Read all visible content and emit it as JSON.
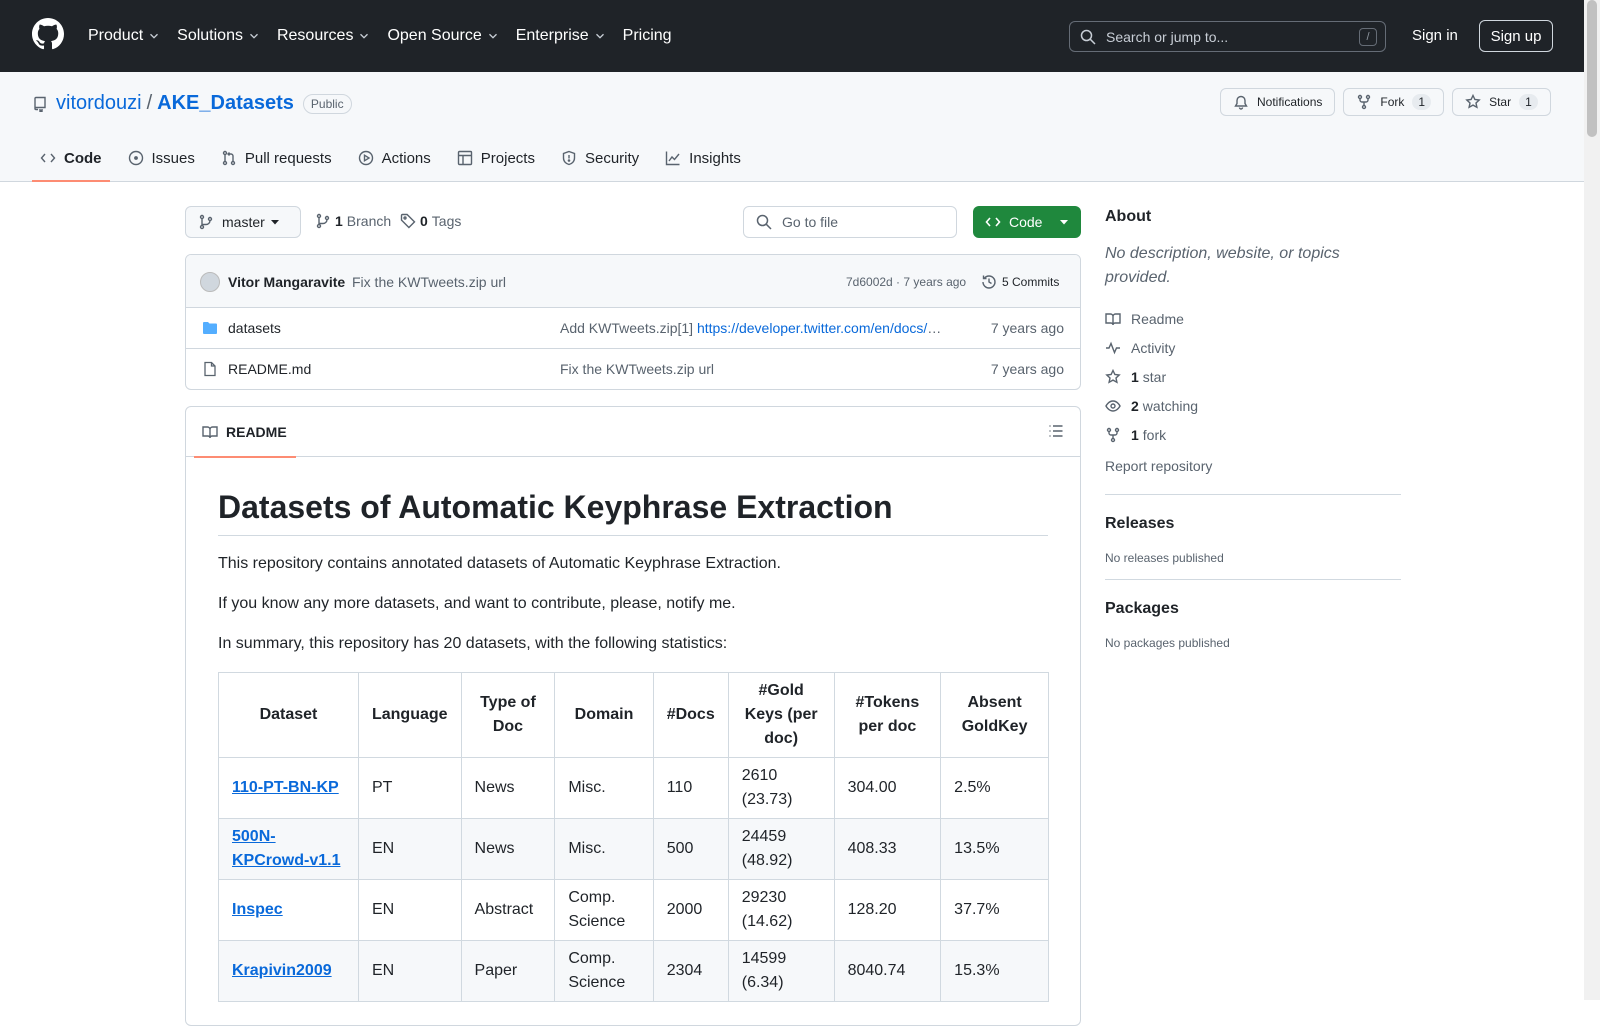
{
  "header": {
    "nav": [
      "Product",
      "Solutions",
      "Resources",
      "Open Source",
      "Enterprise",
      "Pricing"
    ],
    "nav_has_dropdown": [
      true,
      true,
      true,
      true,
      true,
      false
    ],
    "search_placeholder": "Search or jump to...",
    "search_shortcut": "/",
    "signin": "Sign in",
    "signup": "Sign up"
  },
  "repo": {
    "owner": "vitordouzi",
    "separator": "/",
    "name": "AKE_Datasets",
    "visibility": "Public",
    "notifications_label": "Notifications",
    "fork_label": "Fork",
    "fork_count": "1",
    "star_label": "Star",
    "star_count": "1"
  },
  "tabs": [
    "Code",
    "Issues",
    "Pull requests",
    "Actions",
    "Projects",
    "Security",
    "Insights"
  ],
  "toolbar": {
    "branch": "master",
    "branch_count": "1",
    "branch_label": "Branch",
    "tag_count": "0",
    "tag_label": "Tags",
    "goto_placeholder": "Go to file",
    "code_label": "Code"
  },
  "commit": {
    "author": "Vitor Mangaravite",
    "message": "Fix the KWTweets.zip url",
    "hash_time": "7d6002d · 7 years ago",
    "commits": "5 Commits"
  },
  "files": [
    {
      "name": "datasets",
      "type": "folder",
      "msg": "Add KWTweets.zip[1] ",
      "link": "https://developer.twitter.com/en/docs/tweets/search/api-reference/get-search-tweets",
      "date": "7 years ago"
    },
    {
      "name": "README.md",
      "type": "file",
      "msg": "Fix the KWTweets.zip url",
      "link": "",
      "date": "7 years ago"
    }
  ],
  "readme": {
    "tab": "README",
    "title": "Datasets of Automatic Keyphrase Extraction",
    "p1": "This repository contains annotated datasets of Automatic Keyphrase Extraction.",
    "p2": "If you know any more datasets, and want to contribute, please, notify me.",
    "p3": "In summary, this repository has 20 datasets, with the following statistics:",
    "table": {
      "headers": [
        "Dataset",
        "Language",
        "Type of Doc",
        "Domain",
        "#Docs",
        "#Gold Keys (per doc)",
        "#Tokens per doc",
        "Absent GoldKey"
      ],
      "rows": [
        [
          "110-PT-BN-KP",
          "PT",
          "News",
          "Misc.",
          "110",
          "2610 (23.73)",
          "304.00",
          "2.5%"
        ],
        [
          "500N-KPCrowd-v1.1",
          "EN",
          "News",
          "Misc.",
          "500",
          "24459 (48.92)",
          "408.33",
          "13.5%"
        ],
        [
          "Inspec",
          "EN",
          "Abstract",
          "Comp. Science",
          "2000",
          "29230 (14.62)",
          "128.20",
          "37.7%"
        ],
        [
          "Krapivin2009",
          "EN",
          "Paper",
          "Comp. Science",
          "2304",
          "14599 (6.34)",
          "8040.74",
          "15.3%"
        ]
      ]
    }
  },
  "sidebar": {
    "about_title": "About",
    "about_desc": "No description, website, or topics provided.",
    "items": [
      {
        "icon": "book-icon",
        "bold": "",
        "text": "Readme"
      },
      {
        "icon": "pulse-icon",
        "bold": "",
        "text": "Activity"
      },
      {
        "icon": "star-icon",
        "bold": "1",
        "text": "star"
      },
      {
        "icon": "eye-icon",
        "bold": "2",
        "text": "watching"
      },
      {
        "icon": "fork-icon",
        "bold": "1",
        "text": "fork"
      }
    ],
    "report": "Report repository",
    "releases_title": "Releases",
    "releases_text": "No releases published",
    "packages_title": "Packages",
    "packages_text": "No packages published"
  },
  "colors": {
    "header_bg": "#1f2328",
    "link": "#0969da",
    "code_button": "#1f883d",
    "tab_underline": "#fd8c73"
  }
}
